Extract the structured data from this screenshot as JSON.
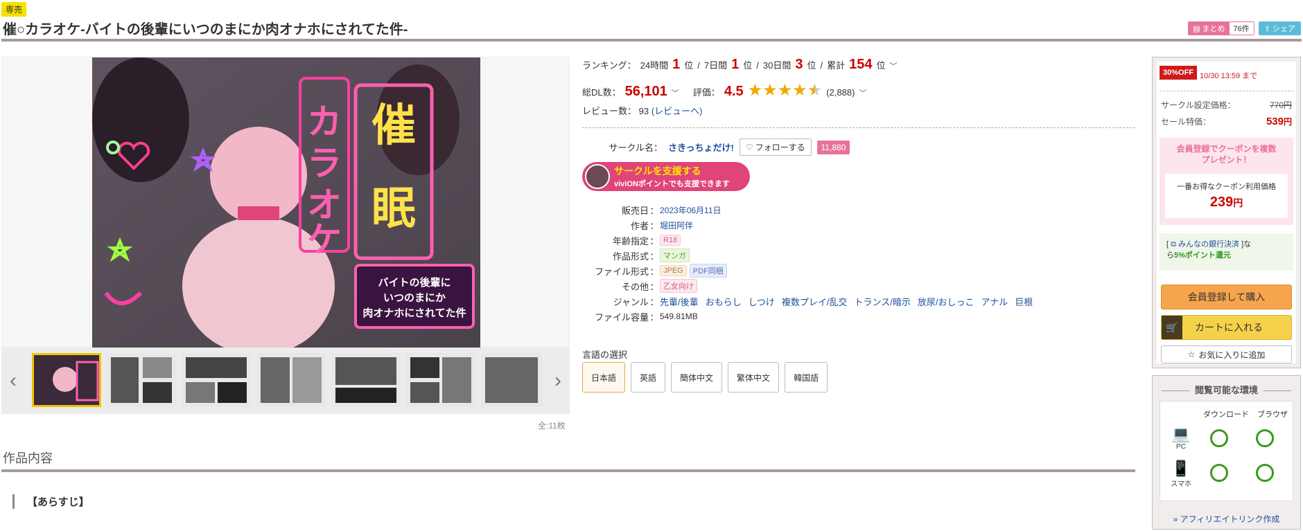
{
  "header": {
    "badge": "専売",
    "title": "催○カラオケ-バイトの後輩にいつのまにか肉オナホにされてた件-",
    "matome_label": "まとめ",
    "matome_count": "76件",
    "share_label": "シェア"
  },
  "gallery": {
    "total": "全:11枚",
    "cover_title_text": "催眠カラオケ",
    "cover_subtitle": "バイトの後輩にいつのまにか肉オナホにされてた件"
  },
  "ranking": {
    "label": "ランキング：",
    "items": [
      {
        "period": "24時間",
        "rank": "1",
        "unit": "位"
      },
      {
        "period": "7日間",
        "rank": "1",
        "unit": "位"
      },
      {
        "period": "30日間",
        "rank": "3",
        "unit": "位"
      },
      {
        "period": "累計",
        "rank": "154",
        "unit": "位"
      }
    ]
  },
  "stats": {
    "dl_label": "総DL数：",
    "dl_value": "56,101",
    "rating_label": "評価：",
    "rating_value": "4.5",
    "rating_stars": 4.5,
    "rating_count": "(2,888)",
    "review_label": "レビュー数：",
    "review_count": "93",
    "review_link": "(レビューへ)"
  },
  "circle": {
    "label": "サークル名：",
    "name": "さきっちょだけ!",
    "follow_label": "フォローする",
    "follow_count": "11,880",
    "support_title": "サークルを支援する",
    "support_sub": "viviONポイントでも支援できます"
  },
  "specs": {
    "release_key": "販売日",
    "release_val": "2023年06月11日",
    "author_key": "作者",
    "author_val": "堀田阿伴",
    "age_key": "年齢指定",
    "age_val": "R18",
    "form_key": "作品形式",
    "form_val": "マンガ",
    "file_key": "ファイル形式",
    "file_vals": [
      "JPEG",
      "PDF同梱"
    ],
    "other_key": "その他",
    "other_val": "乙女向け",
    "genre_key": "ジャンル",
    "genres": [
      "先輩/後輩",
      "おもらし",
      "しつけ",
      "複数プレイ/乱交",
      "トランス/暗示",
      "放尿/おしっこ",
      "アナル",
      "巨根"
    ],
    "size_key": "ファイル容量",
    "size_val": "549.81MB"
  },
  "language": {
    "label": "言語の選択",
    "options": [
      "日本語",
      "英語",
      "簡体中文",
      "繁体中文",
      "韓国語"
    ],
    "selected": "日本語"
  },
  "content": {
    "section_title": "作品内容",
    "synopsis_heading": "【あらすじ】"
  },
  "purchase": {
    "sale_tag": "30%OFF",
    "sale_until": "10/30 13:59 まで",
    "list_price_label": "サークル設定価格：",
    "list_price": "770円",
    "sale_price_label": "セール特価：",
    "sale_price": "539",
    "sale_price_unit": "円",
    "coupon_line1": "会員登録でクーポンを複数",
    "coupon_line2": "プレゼント！",
    "coupon_best_label": "一番お得なクーポン利用価格",
    "coupon_price": "239",
    "coupon_price_unit": "円",
    "bank_pre": "[",
    "bank_link": "みんなの銀行決済",
    "bank_mid": "]な",
    "bank_line2_pre": "ら",
    "bank_green": "5%ポイント還元",
    "register_label": "会員登録して購入",
    "cart_label": "カートに入れる",
    "fav_label": "お気に入りに追加"
  },
  "environment": {
    "title": "閲覧可能な環境",
    "col_download": "ダウンロード",
    "col_browser": "ブラウザ",
    "pc_label": "PC",
    "phone_label": "スマホ",
    "affiliate_label": "» アフィリエイトリンク作成"
  },
  "colors": {
    "accent_red": "#cc0000",
    "pink": "#e8739a",
    "link_blue": "#1a4f9c",
    "register_orange": "#f7a54c",
    "cart_yellow": "#f5d14a",
    "badge_yellow": "#f5e000"
  }
}
